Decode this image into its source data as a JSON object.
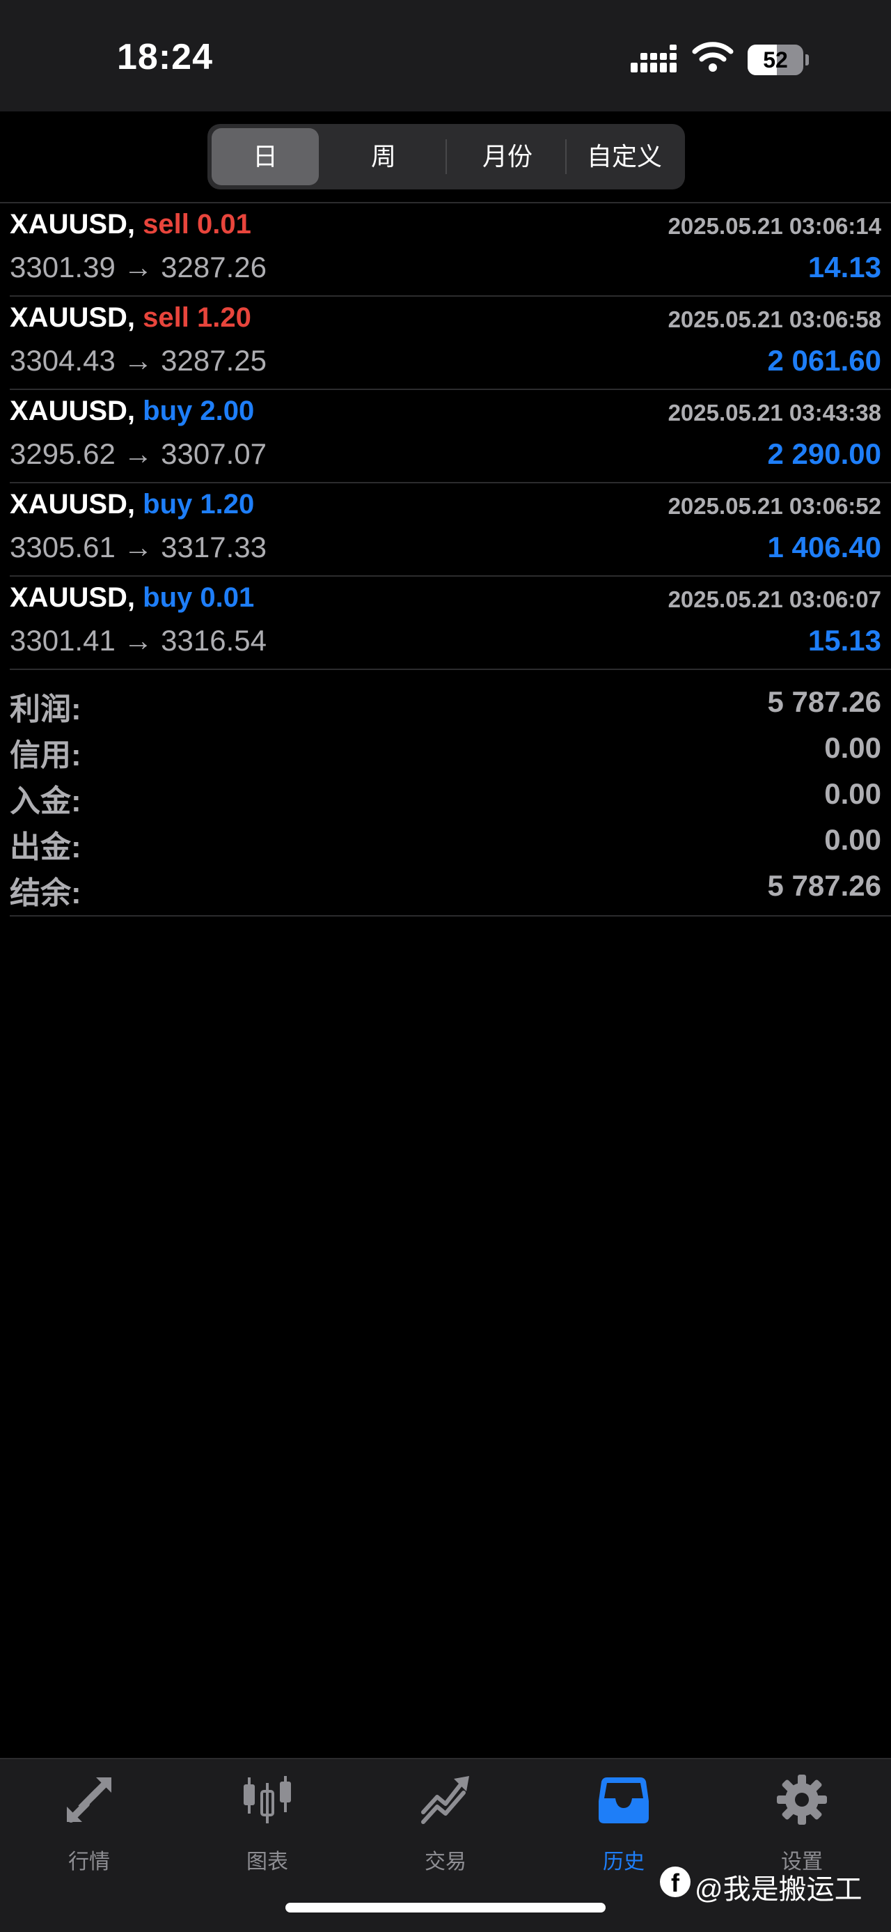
{
  "status_bar": {
    "time": "18:24",
    "battery_level": "52",
    "battery_fraction": 0.52
  },
  "segments": [
    {
      "label": "日",
      "selected": true
    },
    {
      "label": "周",
      "selected": false
    },
    {
      "label": "月份",
      "selected": false
    },
    {
      "label": "自定义",
      "selected": false
    }
  ],
  "trades": [
    {
      "symbol": "XAUUSD,",
      "side": "sell 0.01",
      "datetime": "2025.05.21 03:06:14",
      "prices": "3301.39 → 3287.26",
      "profit": "14.13"
    },
    {
      "symbol": "XAUUSD,",
      "side": "sell 1.20",
      "datetime": "2025.05.21 03:06:58",
      "prices": "3304.43 → 3287.25",
      "profit": "2 061.60"
    },
    {
      "symbol": "XAUUSD,",
      "side": "buy 2.00",
      "datetime": "2025.05.21 03:43:38",
      "prices": "3295.62 → 3307.07",
      "profit": "2 290.00"
    },
    {
      "symbol": "XAUUSD,",
      "side": "buy 1.20",
      "datetime": "2025.05.21 03:06:52",
      "prices": "3305.61 → 3317.33",
      "profit": "1 406.40"
    },
    {
      "symbol": "XAUUSD,",
      "side": "buy 0.01",
      "datetime": "2025.05.21 03:06:07",
      "prices": "3301.41 → 3316.54",
      "profit": "15.13"
    }
  ],
  "summary": [
    {
      "label": "利润:",
      "value": "5 787.26"
    },
    {
      "label": "信用:",
      "value": "0.00"
    },
    {
      "label": "入金:",
      "value": "0.00"
    },
    {
      "label": "出金:",
      "value": "0.00"
    },
    {
      "label": "结余:",
      "value": "5 787.26"
    }
  ],
  "tabs": [
    {
      "label": "行情",
      "icon": "quotes-arrows-icon",
      "active": false
    },
    {
      "label": "图表",
      "icon": "candlestick-chart-icon",
      "active": false
    },
    {
      "label": "交易",
      "icon": "trade-trend-icon",
      "active": false
    },
    {
      "label": "历史",
      "icon": "history-inbox-icon",
      "active": true
    },
    {
      "label": "设置",
      "icon": "gear-icon",
      "active": false
    }
  ],
  "watermark": {
    "logo": "f",
    "text": "@我是搬运工"
  },
  "colors": {
    "sell": "#e8453c",
    "buy": "#1e7ef8",
    "profit": "#1e7ef8",
    "active_tab": "#1e7ef8",
    "inactive": "#8e8e93"
  }
}
